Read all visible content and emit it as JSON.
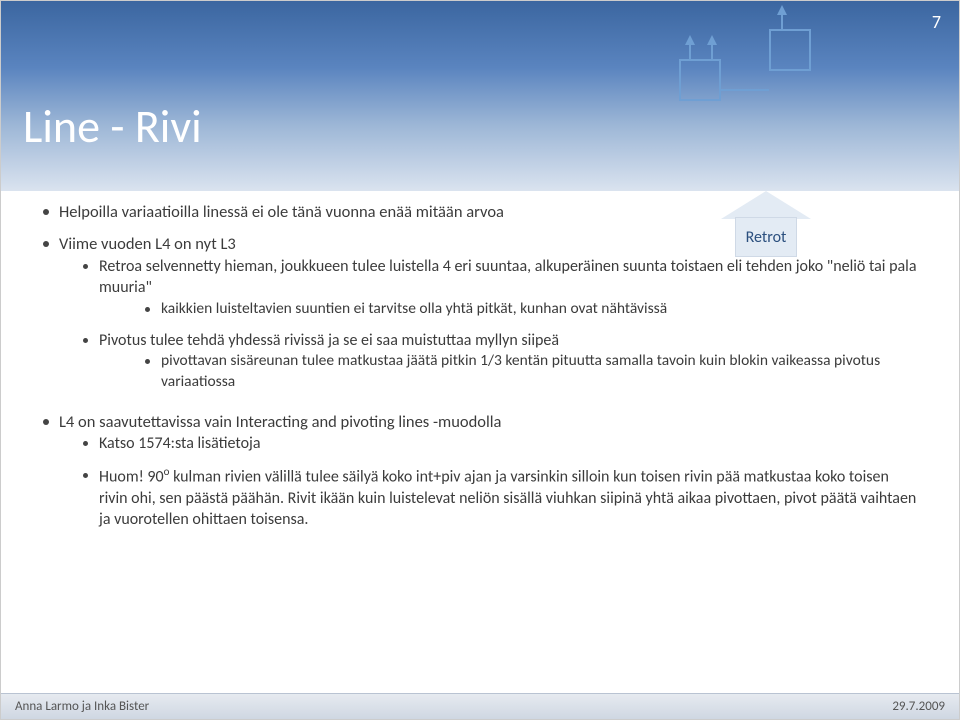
{
  "page_number": "7",
  "title": "Line - Rivi",
  "retrot_label": "Retrot",
  "bullets": {
    "b1": "Helpoilla variaatioilla linessä ei ole tänä vuonna enää mitään arvoa",
    "b2": "Viime vuoden L4 on nyt L3",
    "b2a": "Retroa selvennetty hieman, joukkueen tulee luistella 4 eri suuntaa, alkuperäinen suunta toistaen eli tehden joko \"neliö tai pala muuria\"",
    "b2a1": "kaikkien luisteltavien suuntien ei tarvitse olla yhtä pitkät, kunhan ovat nähtävissä",
    "b2b": "Pivotus tulee tehdä yhdessä rivissä ja se ei saa muistuttaa myllyn siipeä",
    "b2b1": "pivottavan sisäreunan tulee matkustaa jäätä pitkin 1/3 kentän pituutta samalla tavoin kuin blokin vaikeassa pivotus variaatiossa",
    "b3": "L4 on saavutettavissa vain Interacting and pivoting lines -muodolla",
    "b3a": "Katso 1574:sta lisätietoja",
    "b3b_prefix": "Huom!   90",
    "b3b_deg": "o",
    "b3b_rest": "   kulman rivien välillä tulee säilyä koko int+piv ajan ja varsinkin silloin  kun toisen rivin pää matkustaa koko toisen rivin ohi, sen päästä päähän. Rivit ikään kuin luistelevat neliön sisällä viuhkan siipinä yhtä aikaa pivottaen, pivot päätä vaihtaen ja vuorotellen ohittaen toisensa."
  },
  "footer": {
    "authors": "Anna Larmo ja Inka Bister",
    "date": "29.7.2009"
  }
}
